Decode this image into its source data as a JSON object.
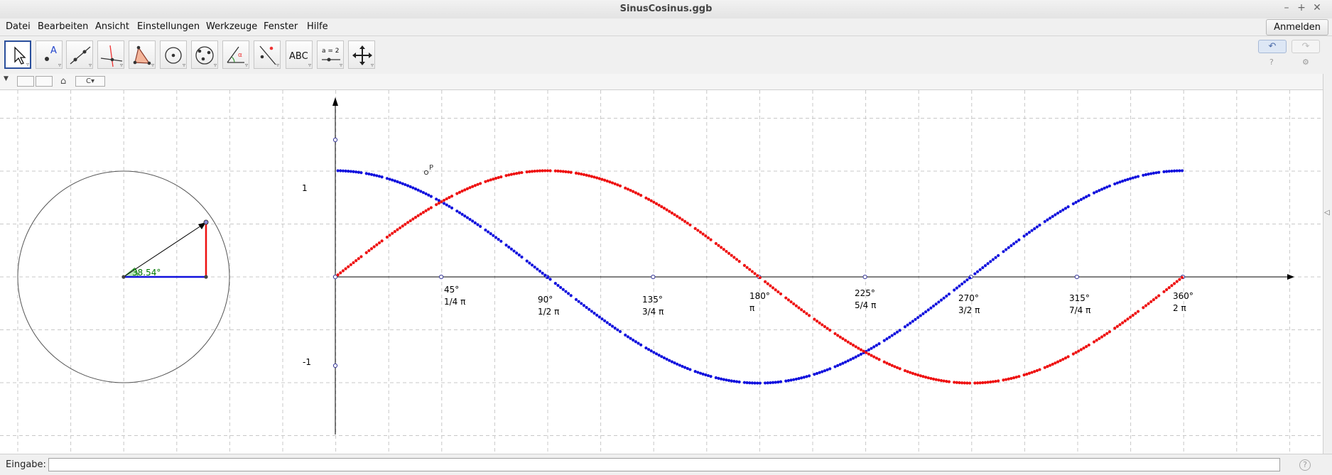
{
  "window": {
    "title": "SinusCosinus.ggb",
    "controls": [
      "–",
      "+",
      "✕"
    ]
  },
  "menubar": {
    "items": [
      "Datei",
      "Bearbeiten",
      "Ansicht",
      "Einstellungen",
      "Werkzeuge",
      "Fenster",
      "Hilfe"
    ],
    "login_label": "Anmelden"
  },
  "toolbar": {
    "tools": [
      {
        "icon": "move-arrow-icon",
        "active": true
      },
      {
        "icon": "point-icon",
        "label": "A"
      },
      {
        "icon": "line-icon"
      },
      {
        "icon": "perpendicular-line-icon"
      },
      {
        "icon": "polygon-icon"
      },
      {
        "icon": "circle-center-point-icon"
      },
      {
        "icon": "circle-three-points-icon"
      },
      {
        "icon": "angle-icon"
      },
      {
        "icon": "reflect-icon"
      },
      {
        "icon": "text-icon",
        "label": "ABC"
      },
      {
        "icon": "slider-icon",
        "label": "a = 2"
      },
      {
        "icon": "move-graphics-icon"
      }
    ],
    "undo_icon": "↶",
    "redo_icon": "↷",
    "help_icon": "?",
    "settings_icon": "⚙"
  },
  "viewbar": {
    "home_icon": "⌂",
    "dropdown_label": "C▾"
  },
  "graphics": {
    "unit_circle": {
      "angle_label": "38.54°",
      "angle_degrees": 38.54,
      "point_label": "P"
    },
    "y_axis_labels": [
      "1",
      "-1"
    ],
    "x_tick_labels": [
      {
        "deg": "45°",
        "rad": "1/4 π"
      },
      {
        "deg": "90°",
        "rad": "1/2 π"
      },
      {
        "deg": "135°",
        "rad": "3/4 π"
      },
      {
        "deg": "180°",
        "rad": "π"
      },
      {
        "deg": "225°",
        "rad": "5/4 π"
      },
      {
        "deg": "270°",
        "rad": "3/2 π"
      },
      {
        "deg": "315°",
        "rad": "7/4 π"
      },
      {
        "deg": "360°",
        "rad": "2 π"
      }
    ],
    "colors": {
      "sine": "#ee1111",
      "cosine": "#1111dd",
      "angle": "#007700",
      "grid": "#c8c8c8",
      "axis": "#000000"
    }
  },
  "inputbar": {
    "label": "Eingabe:",
    "value": "",
    "help_icon": "?"
  }
}
